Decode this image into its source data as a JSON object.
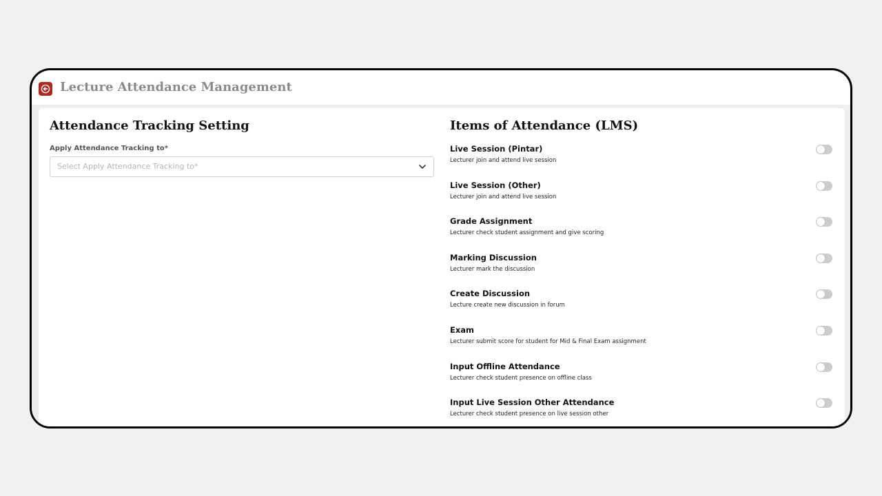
{
  "header": {
    "title": "Lecture Attendance Management",
    "back_icon": "arrow-left-icon",
    "accent_color": "#b3261e"
  },
  "left": {
    "title": "Attendance Tracking Setting",
    "field_label": "Apply Attendance Tracking to*",
    "select_placeholder": "Select Apply Attendance Tracking to*",
    "select_icon": "chevron-down-icon"
  },
  "right": {
    "title": "Items of Attendance (LMS)",
    "items": [
      {
        "title": "Live Session (Pintar)",
        "desc": "Lecturer join and attend live session",
        "enabled": false
      },
      {
        "title": "Live Session (Other)",
        "desc": "Lecturer join and attend live session",
        "enabled": false
      },
      {
        "title": "Grade Assignment",
        "desc": "Lecturer check student assignment and give scoring",
        "enabled": false
      },
      {
        "title": "Marking Discussion",
        "desc": "Lecturer mark the discussion",
        "enabled": false
      },
      {
        "title": "Create Discussion",
        "desc": "Lecture create new discussion in forum",
        "enabled": false
      },
      {
        "title": "Exam",
        "desc": "Lecturer submit score for student for Mid & Final Exam assignment",
        "enabled": false
      },
      {
        "title": "Input Offline Attendance",
        "desc": "Lecturer check student presence on offline class",
        "enabled": false
      },
      {
        "title": "Input Live Session Other Attendance",
        "desc": "Lecturer check student presence on live session other",
        "enabled": false
      }
    ]
  }
}
